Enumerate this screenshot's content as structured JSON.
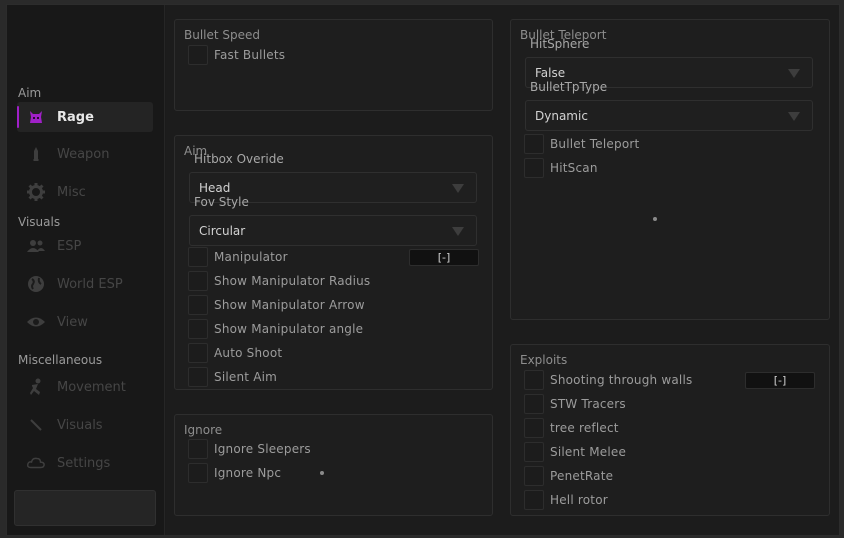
{
  "sidebar": {
    "sections": [
      {
        "title": "Aim",
        "items": [
          {
            "label": "Rage",
            "icon": "demon-icon",
            "active": true
          },
          {
            "label": "Weapon",
            "icon": "bullet-icon"
          },
          {
            "label": "Misc",
            "icon": "gear-icon"
          }
        ]
      },
      {
        "title": "Visuals",
        "items": [
          {
            "label": "ESP",
            "icon": "users-icon"
          },
          {
            "label": "World ESP",
            "icon": "globe-icon"
          },
          {
            "label": "View",
            "icon": "eye-icon"
          }
        ]
      },
      {
        "title": "Miscellaneous",
        "items": [
          {
            "label": "Movement",
            "icon": "running-icon"
          },
          {
            "label": "Visuals",
            "icon": "pencil-icon"
          },
          {
            "label": "Settings",
            "icon": "cloud-icon"
          }
        ]
      }
    ]
  },
  "bullet_speed": {
    "title": "Bullet Speed",
    "checks": [
      "Fast Bullets"
    ]
  },
  "aim": {
    "title": "Aim",
    "hitbox_label": "Hitbox Overide",
    "hitbox_value": "Head",
    "fov_label": "Fov Style",
    "fov_value": "Circular",
    "checks": [
      "Manipulator",
      "Show Manipulator Radius",
      "Show Manipulator Arrow",
      "Show Manipulator angle",
      "Auto Shoot",
      "Silent Aim"
    ],
    "manipulator_key": "[-]"
  },
  "ignore": {
    "title": "Ignore",
    "checks": [
      "Ignore Sleepers",
      "Ignore Npc"
    ]
  },
  "bullet_teleport": {
    "title": "Bullet Teleport",
    "hitsphere_label": "HitSphere",
    "hitsphere_value": "False",
    "tptype_label": "BulletTpType",
    "tptype_value": "Dynamic",
    "checks": [
      "Bullet Teleport",
      "HitScan"
    ]
  },
  "exploits": {
    "title": "Exploits",
    "checks": [
      "Shooting through walls",
      "STW Tracers",
      "tree reflect",
      "Silent Melee",
      "PenetRate",
      "Hell rotor"
    ],
    "stw_key": "[-]"
  },
  "colors": {
    "accent": "#a020c8",
    "background": "#1c1c1c"
  }
}
